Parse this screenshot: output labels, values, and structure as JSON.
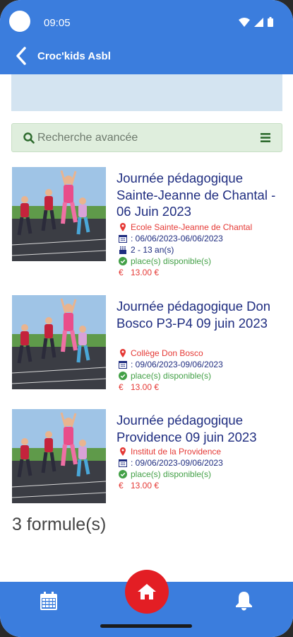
{
  "status_bar": {
    "time": "09:05"
  },
  "header": {
    "title": "Croc'kids Asbl"
  },
  "search": {
    "placeholder": "Recherche avancée"
  },
  "items": [
    {
      "title": "Journée pédagogique Sainte-Jeanne de Chantal - 06 Juin 2023",
      "location": "Ecole Sainte-Jeanne de Chantal",
      "dates": ": 06/06/2023-06/06/2023",
      "age": "2 - 13 an(s)",
      "availability": "place(s) disponible(s)",
      "price": "13.00 €"
    },
    {
      "title": "Journée pédagogique Don Bosco P3-P4 09 juin 2023",
      "location": "Collège Don Bosco",
      "dates": ": 09/06/2023-09/06/2023",
      "availability": "place(s) disponible(s)",
      "price": "13.00 €"
    },
    {
      "title": "Journée pédagogique Providence 09 juin 2023",
      "location": "Institut de la Providence",
      "dates": ": 09/06/2023-09/06/2023",
      "availability": "place(s) disponible(s)",
      "price": "13.00 €"
    }
  ],
  "result_count": "3 formule(s)",
  "icons": {
    "back": "chevron-left-icon",
    "search": "search-icon",
    "menu": "hamburger-icon",
    "location": "map-marker-icon",
    "calendar": "calendar-icon",
    "age": "birthday-cake-icon",
    "availability": "check-circle-icon",
    "price": "euro-icon",
    "home": "home-icon",
    "bell": "bell-icon"
  },
  "colors": {
    "primary": "#3b7ddd",
    "title": "#1f2d80",
    "accent_red": "#e31e24",
    "available_green": "#43a047"
  }
}
